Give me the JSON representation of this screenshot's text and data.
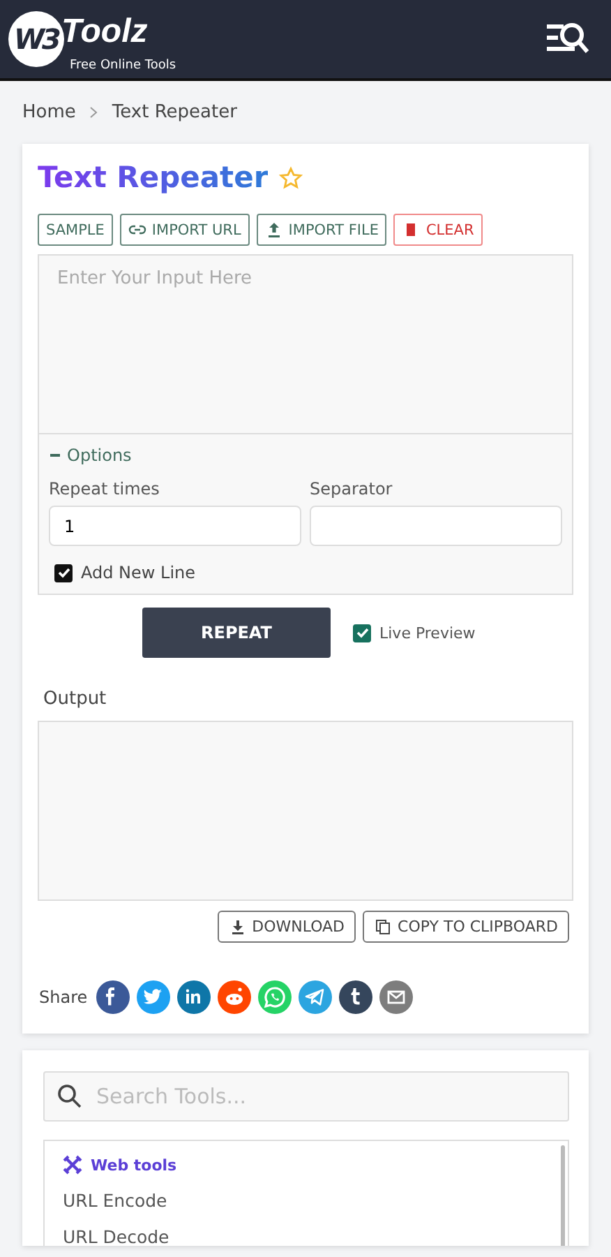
{
  "header": {
    "logo_mark": "W3",
    "logo_name": "Toolz",
    "tagline": "Free Online Tools"
  },
  "breadcrumb": [
    "Home",
    "Text Repeater"
  ],
  "tool": {
    "title": "Text Repeater",
    "actions": [
      {
        "label": "SAMPLE",
        "kind": "plain"
      },
      {
        "label": "IMPORT URL",
        "kind": "link"
      },
      {
        "label": "IMPORT FILE",
        "kind": "upload"
      },
      {
        "label": "CLEAR",
        "kind": "danger"
      }
    ],
    "input": {
      "placeholder": "Enter Your Input Here"
    },
    "options": {
      "label": "Options",
      "expanded": true,
      "repeat_times": {
        "label": "Repeat times",
        "value": "1"
      },
      "separator": {
        "label": "Separator"
      },
      "add_new_line": {
        "label": "Add New Line",
        "checked": true
      }
    },
    "repeat_button": "REPEAT",
    "live_preview": {
      "label": "Live Preview",
      "checked": true
    },
    "output_label": "Output",
    "output_actions": [
      {
        "label": "DOWNLOAD",
        "kind": "download"
      },
      {
        "label": "COPY TO CLIPBOARD",
        "kind": "copy"
      }
    ],
    "share_label": "Share",
    "share": [
      {
        "kind": "facebook",
        "color": "#3b5998"
      },
      {
        "kind": "twitter",
        "color": "#1da1f2"
      },
      {
        "kind": "linkedin",
        "color": "#0e76a8"
      },
      {
        "kind": "reddit",
        "color": "#ff4500"
      },
      {
        "kind": "whatsapp",
        "color": "#25d366"
      },
      {
        "kind": "telegram",
        "color": "#2ca5e0"
      },
      {
        "kind": "tumblr",
        "color": "#35465c"
      },
      {
        "kind": "email",
        "color": "#7d7d7d"
      }
    ]
  },
  "tool_search": {
    "placeholder": "Search Tools..."
  },
  "tool_list": {
    "category": "Web tools",
    "items": [
      "URL Encode",
      "URL Decode"
    ]
  }
}
